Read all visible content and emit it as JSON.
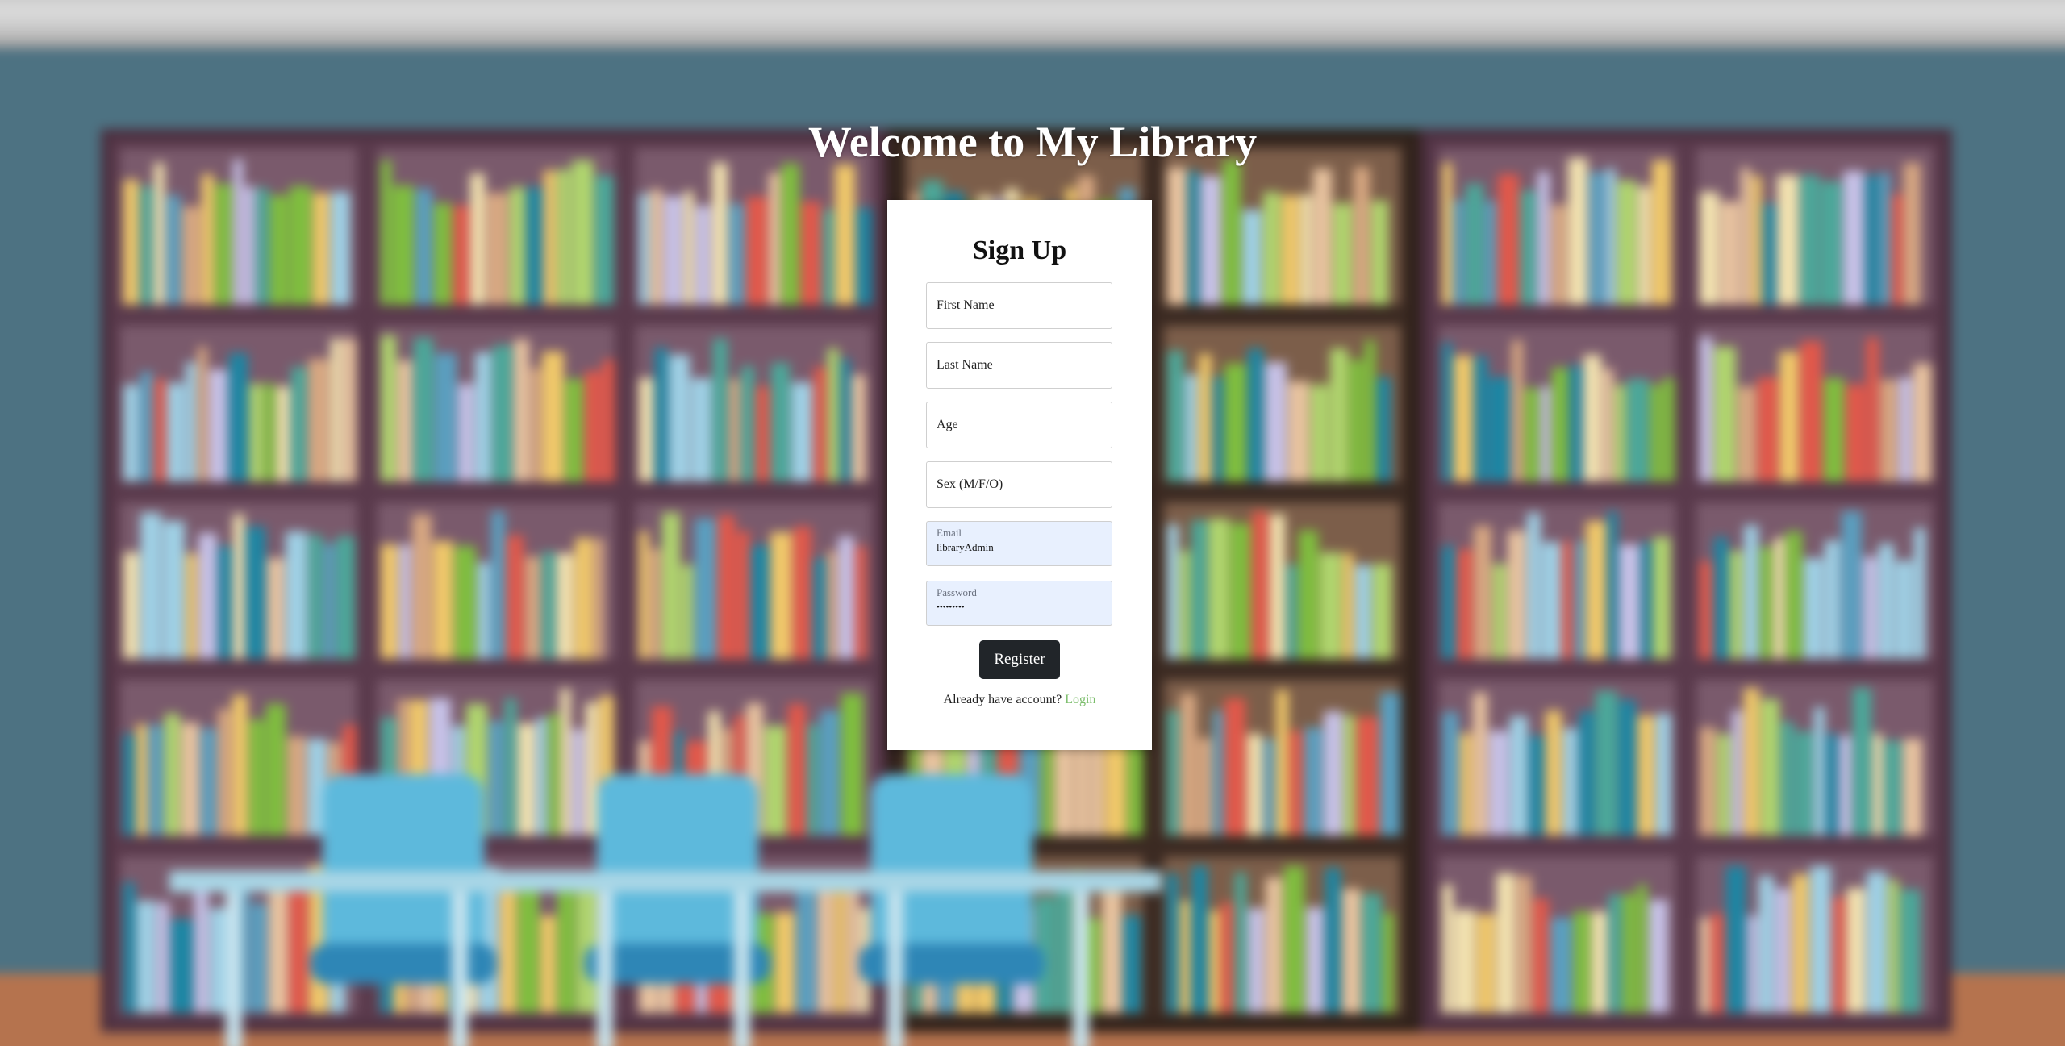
{
  "page": {
    "heading": "Welcome to My Library"
  },
  "form": {
    "title": "Sign Up",
    "first_name_placeholder": "First Name",
    "last_name_placeholder": "Last Name",
    "age_placeholder": "Age",
    "sex_placeholder": "Sex (M/F/O)",
    "email_label": "Email",
    "email_value": "libraryAdmin",
    "password_label": "Password",
    "password_value": "•••••••••",
    "register_label": "Register",
    "login_prompt": "Already have account?",
    "login_link": "Login"
  },
  "colors": {
    "button_bg": "#212529",
    "link": "#7bbd6b",
    "autofill_bg": "#e8f0fe"
  }
}
